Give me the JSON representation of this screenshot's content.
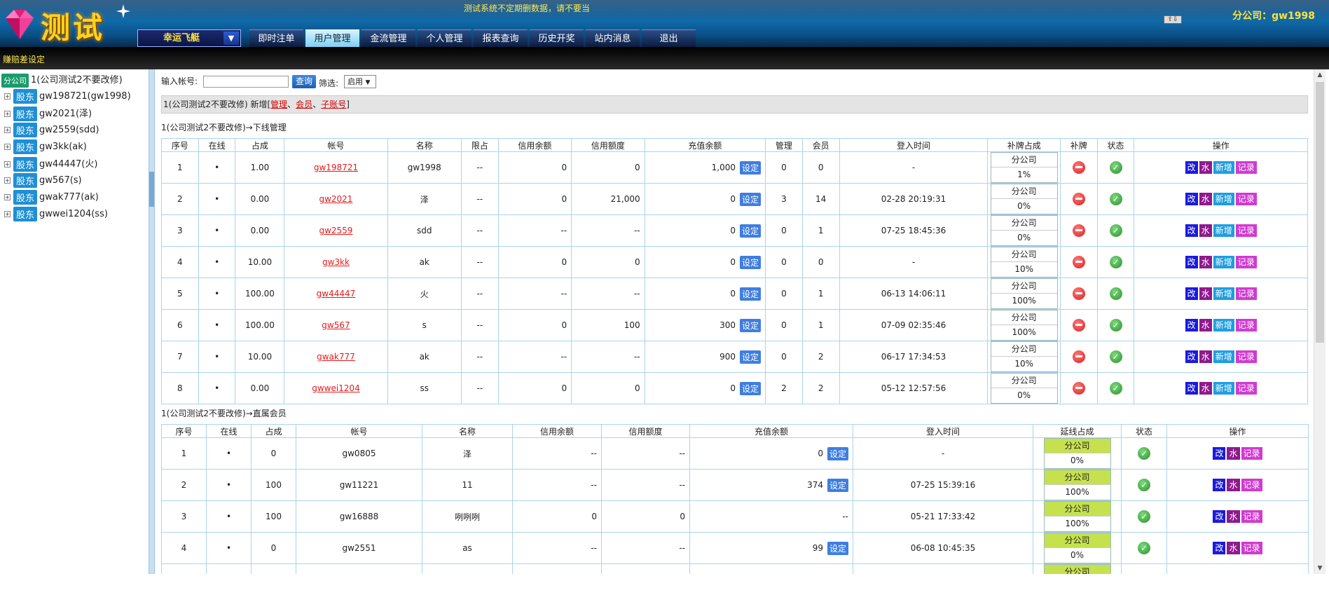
{
  "header": {
    "logo_text": "测试",
    "notice": "测试系统不定期删数据，请不要当",
    "company_label": "分公司：gw1998",
    "scroll_buttons": "⇧⇩",
    "game_select": "幸运飞艇",
    "game_select_arrow": "▼"
  },
  "nav": [
    {
      "label": "即时注单",
      "active": false
    },
    {
      "label": "用户管理",
      "active": true
    },
    {
      "label": "金流管理",
      "active": false
    },
    {
      "label": "个人管理",
      "active": false
    },
    {
      "label": "报表查询",
      "active": false
    },
    {
      "label": "历史开奖",
      "active": false
    },
    {
      "label": "站内消息",
      "active": false
    },
    {
      "label": "退出",
      "active": false
    }
  ],
  "subbar": {
    "title": "赚赔差设定"
  },
  "sidebar": {
    "root_badge": "分公司",
    "root_label": "1(公司测试2不要改修)",
    "items": [
      {
        "badge": "股东",
        "label": "gw198721(gw1998)"
      },
      {
        "badge": "股东",
        "label": "gw2021(泽)"
      },
      {
        "badge": "股东",
        "label": "gw2559(sdd)"
      },
      {
        "badge": "股东",
        "label": "gw3kk(ak)"
      },
      {
        "badge": "股东",
        "label": "gw44447(火)"
      },
      {
        "badge": "股东",
        "label": "gw567(s)"
      },
      {
        "badge": "股东",
        "label": "gwak777(ak)"
      },
      {
        "badge": "股东",
        "label": "gwwei1204(ss)"
      }
    ]
  },
  "search": {
    "label": "输入帐号:",
    "value": "",
    "button": "查询",
    "filter_label": "筛选:",
    "filter_value": "启用",
    "filter_arrow": "▼"
  },
  "add_bar": {
    "prefix": "1(公司测试2不要改修) 新增[",
    "link1": "管理",
    "sep1": "、",
    "link2": "会员",
    "sep2": "、",
    "link3": "子账号",
    "suffix": "]"
  },
  "downline": {
    "title": "1(公司测试2不要改修)→下线管理",
    "headers": [
      "序号",
      "在线",
      "占成",
      "帐号",
      "名称",
      "限占",
      "信用余额",
      "信用额度",
      "充值余额",
      "管理",
      "会员",
      "登入时间",
      "补牌占成",
      "补牌",
      "状态",
      "操作"
    ],
    "set_label": "设定",
    "occ_top": "分公司",
    "actions": [
      "改",
      "水",
      "新增",
      "记录"
    ],
    "rows": [
      {
        "no": "1",
        "online": "•",
        "share": "1.00",
        "account": "gw198721",
        "name": "gw1998",
        "limit": "--",
        "credit_bal": "0",
        "credit_lim": "0",
        "recharge": "1,000",
        "mgr": "0",
        "members": "0",
        "login": "-",
        "occ": "1%"
      },
      {
        "no": "2",
        "online": "•",
        "share": "0.00",
        "account": "gw2021",
        "name": "泽",
        "limit": "--",
        "credit_bal": "0",
        "credit_lim": "21,000",
        "recharge": "0",
        "mgr": "3",
        "members": "14",
        "login": "02-28 20:19:31",
        "occ": "0%"
      },
      {
        "no": "3",
        "online": "•",
        "share": "0.00",
        "account": "gw2559",
        "name": "sdd",
        "limit": "--",
        "credit_bal": "--",
        "credit_lim": "--",
        "recharge": "0",
        "mgr": "0",
        "members": "1",
        "login": "07-25 18:45:36",
        "occ": "0%"
      },
      {
        "no": "4",
        "online": "•",
        "share": "10.00",
        "account": "gw3kk",
        "name": "ak",
        "limit": "--",
        "credit_bal": "0",
        "credit_lim": "0",
        "recharge": "0",
        "mgr": "0",
        "members": "0",
        "login": "-",
        "occ": "10%"
      },
      {
        "no": "5",
        "online": "•",
        "share": "100.00",
        "account": "gw44447",
        "name": "火",
        "limit": "--",
        "credit_bal": "--",
        "credit_lim": "--",
        "recharge": "0",
        "mgr": "0",
        "members": "1",
        "login": "06-13 14:06:11",
        "occ": "100%"
      },
      {
        "no": "6",
        "online": "•",
        "share": "100.00",
        "account": "gw567",
        "name": "s",
        "limit": "--",
        "credit_bal": "0",
        "credit_lim": "100",
        "recharge": "300",
        "mgr": "0",
        "members": "1",
        "login": "07-09 02:35:46",
        "occ": "100%"
      },
      {
        "no": "7",
        "online": "•",
        "share": "10.00",
        "account": "gwak777",
        "name": "ak",
        "limit": "--",
        "credit_bal": "--",
        "credit_lim": "--",
        "recharge": "900",
        "mgr": "0",
        "members": "2",
        "login": "06-17 17:34:53",
        "occ": "10%"
      },
      {
        "no": "8",
        "online": "•",
        "share": "0.00",
        "account": "gwwei1204",
        "name": "ss",
        "limit": "--",
        "credit_bal": "0",
        "credit_lim": "0",
        "recharge": "0",
        "mgr": "2",
        "members": "2",
        "login": "05-12 12:57:56",
        "occ": "0%"
      }
    ]
  },
  "members": {
    "title": "1(公司测试2不要改修)→直属会员",
    "headers": [
      "序号",
      "在线",
      "占成",
      "帐号",
      "名称",
      "信用余额",
      "信用额度",
      "充值余额",
      "登入时间",
      "延线占成",
      "状态",
      "操作"
    ],
    "set_label": "设定",
    "occ_top": "分公司",
    "actions": [
      "改",
      "水",
      "记录"
    ],
    "rows": [
      {
        "no": "1",
        "online": "•",
        "share": "0",
        "account": "gw0805",
        "name": "泽",
        "credit_bal": "--",
        "credit_lim": "--",
        "recharge": "0",
        "has_set": true,
        "login": "-",
        "occ": "0%"
      },
      {
        "no": "2",
        "online": "•",
        "share": "100",
        "account": "gw11221",
        "name": "11",
        "credit_bal": "--",
        "credit_lim": "--",
        "recharge": "374",
        "has_set": true,
        "login": "07-25 15:39:16",
        "occ": "100%"
      },
      {
        "no": "3",
        "online": "•",
        "share": "100",
        "account": "gw16888",
        "name": "咧咧咧",
        "credit_bal": "0",
        "credit_lim": "0",
        "recharge": "--",
        "has_set": false,
        "login": "05-21 17:33:42",
        "occ": "100%"
      },
      {
        "no": "4",
        "online": "•",
        "share": "0",
        "account": "gw2551",
        "name": "as",
        "credit_bal": "--",
        "credit_lim": "--",
        "recharge": "99",
        "has_set": true,
        "login": "06-08 10:45:35",
        "occ": "0%"
      }
    ],
    "partial_row": {
      "occ": "分公司"
    }
  },
  "colors": {
    "accent": "#1e8fd6",
    "link_red": "#e41b1b",
    "header_blue": "#0f6aa9",
    "occ_green": "#c5e14e"
  }
}
